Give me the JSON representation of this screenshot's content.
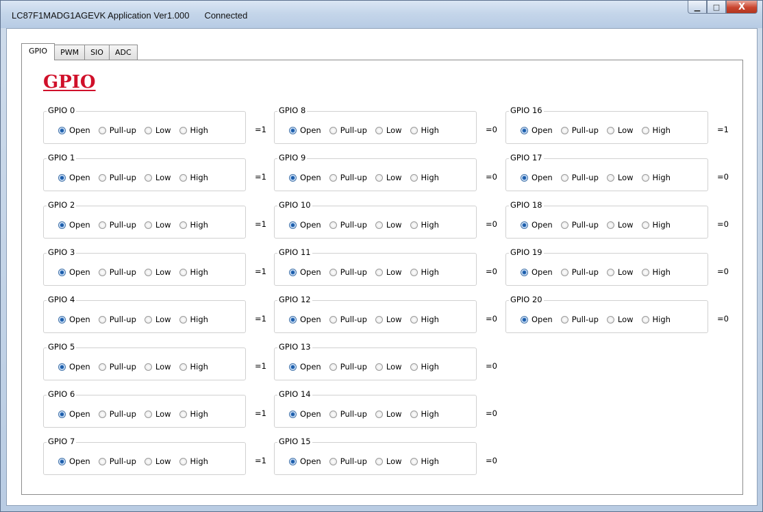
{
  "window": {
    "title": "LC87F1MADG1AGEVK Application Ver1.000",
    "status": "Connected",
    "minimize": "▁",
    "maximize": "□",
    "close": "X"
  },
  "tabs": [
    "GPIO",
    "PWM",
    "SIO",
    "ADC"
  ],
  "active_tab": "GPIO",
  "heading": "GPIO",
  "options": [
    "Open",
    "Pull-up",
    "Low",
    "High"
  ],
  "gpio": [
    {
      "label": "GPIO 0",
      "selected": "Open",
      "value": "=1"
    },
    {
      "label": "GPIO 1",
      "selected": "Open",
      "value": "=1"
    },
    {
      "label": "GPIO 2",
      "selected": "Open",
      "value": "=1"
    },
    {
      "label": "GPIO 3",
      "selected": "Open",
      "value": "=1"
    },
    {
      "label": "GPIO 4",
      "selected": "Open",
      "value": "=1"
    },
    {
      "label": "GPIO 5",
      "selected": "Open",
      "value": "=1"
    },
    {
      "label": "GPIO 6",
      "selected": "Open",
      "value": "=1"
    },
    {
      "label": "GPIO 7",
      "selected": "Open",
      "value": "=1"
    },
    {
      "label": "GPIO 8",
      "selected": "Open",
      "value": "=0"
    },
    {
      "label": "GPIO 9",
      "selected": "Open",
      "value": "=0"
    },
    {
      "label": "GPIO 10",
      "selected": "Open",
      "value": "=0"
    },
    {
      "label": "GPIO 11",
      "selected": "Open",
      "value": "=0"
    },
    {
      "label": "GPIO 12",
      "selected": "Open",
      "value": "=0"
    },
    {
      "label": "GPIO 13",
      "selected": "Open",
      "value": "=0"
    },
    {
      "label": "GPIO 14",
      "selected": "Open",
      "value": "=0"
    },
    {
      "label": "GPIO 15",
      "selected": "Open",
      "value": "=0"
    },
    {
      "label": "GPIO 16",
      "selected": "Open",
      "value": "=1"
    },
    {
      "label": "GPIO 17",
      "selected": "Open",
      "value": "=0"
    },
    {
      "label": "GPIO 18",
      "selected": "Open",
      "value": "=0"
    },
    {
      "label": "GPIO 19",
      "selected": "Open",
      "value": "=0"
    },
    {
      "label": "GPIO 20",
      "selected": "Open",
      "value": "=0"
    }
  ]
}
